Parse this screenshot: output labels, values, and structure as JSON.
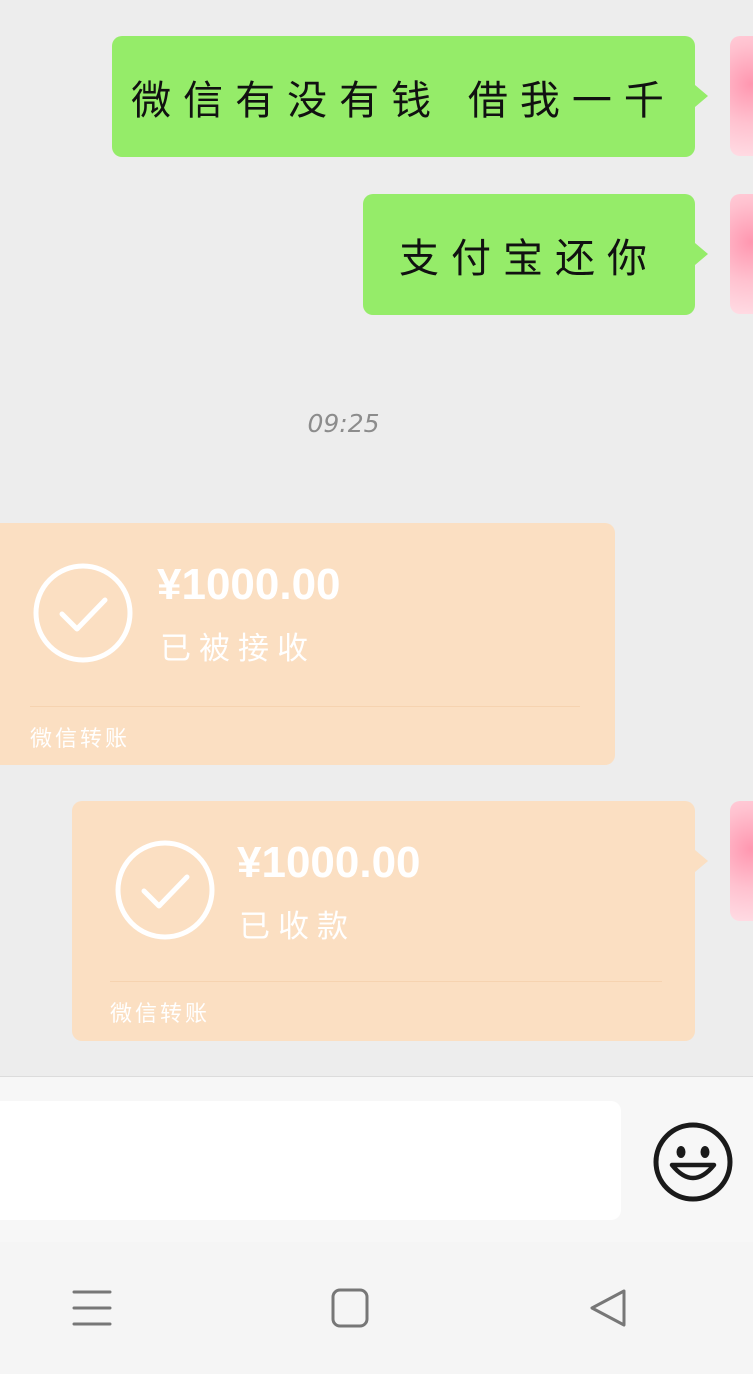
{
  "messages": {
    "msg1": "微信有没有钱 借我一千",
    "msg2": "支付宝还你"
  },
  "timestamp": "09:25",
  "transfer_received": {
    "amount": "¥1000.00",
    "status": "已被接收",
    "footer": "微信转账"
  },
  "transfer_sent": {
    "amount": "¥1000.00",
    "status": "已收款",
    "footer": "微信转账"
  },
  "input": {
    "value": "",
    "placeholder": ""
  },
  "icons": {
    "emoji": "emoji-icon",
    "menu": "menu-icon",
    "home": "home-icon",
    "back": "back-icon",
    "check": "check-circle-icon"
  },
  "colors": {
    "chat_bg": "#ededed",
    "sent_bubble": "#95ec69",
    "transfer_bubble": "#fbdfc2",
    "timestamp_text": "#8c8c8c"
  }
}
